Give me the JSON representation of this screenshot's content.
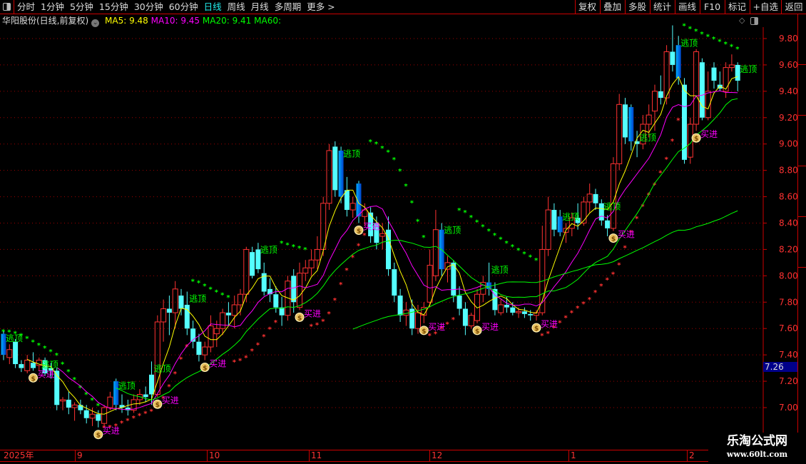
{
  "toolbar": {
    "periods": [
      "分时",
      "1分钟",
      "5分钟",
      "15分钟",
      "30分钟",
      "60分钟",
      "日线",
      "周线",
      "月线",
      "多周期",
      "更多 >"
    ],
    "active_period": "日线",
    "actions": [
      "复权",
      "叠加",
      "多股",
      "统计",
      "画线",
      "F10",
      "标记",
      "+自选",
      "返回"
    ]
  },
  "info": {
    "stock": "华阳股份(日线,前复权)",
    "ma5": "MA5: 9.48",
    "ma10": "MA10: 9.45",
    "ma20": "MA20: 9.41",
    "ma60": "MA60:"
  },
  "colors": {
    "up": "#ff3232",
    "down": "#54ffff",
    "ma5": "#ffff00",
    "ma10": "#ff00ff",
    "ma20": "#00ff00",
    "top_signal": "#00ff00",
    "buy_signal": "#ff00ff",
    "grid": "#a00000",
    "axis": "#ff3232"
  },
  "price_tag": "7.26",
  "time_axis": {
    "labels": [
      "2025年",
      "9",
      "10",
      "11",
      "12",
      "1",
      "2"
    ]
  },
  "watermark": {
    "line1": "乐淘公式网",
    "line2": "www.60lt.com"
  },
  "chart_data": {
    "type": "candlestick",
    "ylim": [
      6.8,
      9.95
    ],
    "yticks": [
      "9.80",
      "9.60",
      "9.40",
      "9.20",
      "9.00",
      "8.80",
      "8.60",
      "8.40",
      "8.20",
      "8.00",
      "7.80",
      "7.60",
      "7.40",
      "7.20",
      "7.00"
    ],
    "grid": true,
    "ohlc": [
      [
        7.56,
        7.58,
        7.36,
        7.4
      ],
      [
        7.38,
        7.48,
        7.33,
        7.44
      ],
      [
        7.5,
        7.52,
        7.3,
        7.33
      ],
      [
        7.33,
        7.36,
        7.27,
        7.3
      ],
      [
        7.28,
        7.4,
        7.26,
        7.36
      ],
      [
        7.34,
        7.42,
        7.28,
        7.3
      ],
      [
        7.32,
        7.38,
        7.28,
        7.36
      ],
      [
        7.36,
        7.38,
        7.24,
        7.26
      ],
      [
        7.3,
        7.34,
        7.22,
        7.28
      ],
      [
        7.28,
        7.3,
        6.98,
        7.02
      ],
      [
        7.05,
        7.08,
        6.98,
        7.06
      ],
      [
        7.06,
        7.12,
        6.95,
        7.0
      ],
      [
        7.0,
        7.04,
        6.9,
        7.02
      ],
      [
        7.02,
        7.06,
        6.95,
        6.98
      ],
      [
        6.98,
        7.02,
        6.88,
        6.92
      ],
      [
        6.92,
        7.0,
        6.86,
        6.95
      ],
      [
        6.95,
        6.98,
        6.85,
        6.9
      ],
      [
        6.88,
        7.02,
        6.85,
        7.0
      ],
      [
        7.0,
        7.12,
        6.98,
        7.08
      ],
      [
        7.2,
        7.22,
        6.98,
        7.02
      ],
      [
        7.02,
        7.1,
        6.96,
        7.0
      ],
      [
        7.0,
        7.06,
        6.94,
        6.98
      ],
      [
        6.98,
        7.1,
        6.96,
        7.06
      ],
      [
        7.06,
        7.14,
        7.02,
        7.1
      ],
      [
        7.1,
        7.16,
        7.04,
        7.08
      ],
      [
        7.25,
        7.35,
        7.02,
        7.1
      ],
      [
        7.1,
        7.7,
        7.08,
        7.65
      ],
      [
        7.65,
        7.82,
        7.5,
        7.75
      ],
      [
        7.75,
        7.85,
        7.55,
        7.72
      ],
      [
        7.72,
        7.96,
        7.6,
        7.9
      ],
      [
        7.85,
        7.9,
        7.7,
        7.75
      ],
      [
        7.78,
        7.88,
        7.55,
        7.6
      ],
      [
        7.6,
        7.66,
        7.45,
        7.5
      ],
      [
        7.5,
        7.56,
        7.35,
        7.4
      ],
      [
        7.4,
        7.5,
        7.36,
        7.46
      ],
      [
        7.46,
        7.7,
        7.42,
        7.62
      ],
      [
        7.56,
        7.66,
        7.46,
        7.6
      ],
      [
        7.6,
        7.75,
        7.55,
        7.72
      ],
      [
        7.72,
        7.8,
        7.62,
        7.7
      ],
      [
        7.7,
        7.85,
        7.6,
        7.78
      ],
      [
        7.78,
        7.9,
        7.7,
        7.86
      ],
      [
        7.86,
        8.22,
        7.8,
        8.2
      ],
      [
        8.18,
        8.22,
        7.98,
        8.0
      ],
      [
        8.2,
        8.25,
        8.02,
        8.05
      ],
      [
        8.02,
        8.1,
        7.85,
        7.88
      ],
      [
        7.9,
        7.98,
        7.8,
        7.86
      ],
      [
        7.86,
        7.92,
        7.72,
        7.76
      ],
      [
        7.76,
        7.84,
        7.62,
        7.7
      ],
      [
        7.7,
        8.0,
        7.66,
        7.96
      ],
      [
        8.0,
        8.05,
        7.72,
        7.8
      ],
      [
        7.76,
        8.1,
        7.74,
        8.02
      ],
      [
        8.02,
        8.12,
        7.96,
        8.06
      ],
      [
        8.06,
        8.2,
        8.0,
        8.12
      ],
      [
        8.12,
        8.3,
        8.05,
        8.2
      ],
      [
        8.2,
        8.6,
        8.15,
        8.55
      ],
      [
        8.55,
        9.0,
        8.5,
        8.95
      ],
      [
        8.98,
        9.02,
        8.6,
        8.65
      ],
      [
        8.95,
        8.98,
        8.55,
        8.6
      ],
      [
        8.65,
        8.75,
        8.45,
        8.5
      ],
      [
        8.5,
        8.6,
        8.44,
        8.55
      ],
      [
        8.7,
        8.72,
        8.4,
        8.45
      ],
      [
        8.45,
        8.55,
        8.38,
        8.5
      ],
      [
        8.48,
        8.52,
        8.25,
        8.3
      ],
      [
        8.4,
        8.45,
        8.2,
        8.25
      ],
      [
        8.3,
        8.4,
        8.2,
        8.32
      ],
      [
        8.35,
        8.45,
        8.0,
        8.05
      ],
      [
        8.05,
        8.1,
        7.8,
        7.85
      ],
      [
        7.85,
        7.9,
        7.65,
        7.7
      ],
      [
        7.7,
        7.8,
        7.62,
        7.74
      ],
      [
        7.75,
        7.82,
        7.55,
        7.6
      ],
      [
        7.6,
        7.78,
        7.56,
        7.72
      ],
      [
        7.7,
        7.8,
        7.64,
        7.76
      ],
      [
        7.8,
        8.2,
        7.76,
        8.08
      ],
      [
        8.0,
        8.5,
        7.96,
        8.35
      ],
      [
        8.35,
        8.4,
        8.0,
        8.05
      ],
      [
        8.05,
        8.15,
        7.95,
        8.1
      ],
      [
        8.1,
        8.12,
        7.8,
        7.85
      ],
      [
        7.85,
        7.92,
        7.7,
        7.75
      ],
      [
        7.75,
        7.8,
        7.55,
        7.62
      ],
      [
        7.62,
        7.72,
        7.6,
        7.7
      ],
      [
        7.66,
        7.9,
        7.64,
        7.86
      ],
      [
        7.86,
        8.0,
        7.8,
        7.95
      ],
      [
        7.95,
        8.1,
        7.85,
        7.9
      ],
      [
        7.9,
        7.95,
        7.7,
        7.74
      ],
      [
        7.72,
        7.82,
        7.7,
        7.78
      ],
      [
        7.78,
        7.84,
        7.72,
        7.76
      ],
      [
        7.76,
        7.8,
        7.7,
        7.72
      ],
      [
        7.72,
        7.76,
        7.68,
        7.73
      ],
      [
        7.73,
        7.76,
        7.68,
        7.71
      ],
      [
        7.71,
        7.74,
        7.66,
        7.7
      ],
      [
        7.7,
        7.74,
        7.66,
        7.72
      ],
      [
        7.72,
        8.38,
        7.7,
        8.2
      ],
      [
        8.2,
        8.6,
        8.15,
        8.5
      ],
      [
        8.5,
        8.55,
        8.3,
        8.35
      ],
      [
        8.45,
        8.5,
        8.3,
        8.33
      ],
      [
        8.33,
        8.4,
        8.25,
        8.36
      ],
      [
        8.36,
        8.48,
        8.3,
        8.44
      ],
      [
        8.44,
        8.55,
        8.35,
        8.4
      ],
      [
        8.4,
        8.6,
        8.38,
        8.56
      ],
      [
        8.56,
        8.7,
        8.48,
        8.62
      ],
      [
        8.62,
        8.66,
        8.5,
        8.55
      ],
      [
        8.55,
        8.58,
        8.38,
        8.42
      ],
      [
        8.42,
        8.46,
        8.3,
        8.36
      ],
      [
        8.36,
        8.9,
        8.34,
        8.85
      ],
      [
        8.85,
        9.38,
        8.8,
        9.3
      ],
      [
        9.3,
        9.35,
        9.0,
        9.05
      ],
      [
        9.28,
        9.3,
        8.95,
        9.02
      ],
      [
        9.02,
        9.1,
        8.9,
        9.0
      ],
      [
        9.0,
        9.22,
        8.96,
        9.15
      ],
      [
        9.15,
        9.3,
        9.05,
        9.22
      ],
      [
        9.25,
        9.45,
        9.1,
        9.4
      ],
      [
        9.4,
        9.52,
        9.3,
        9.35
      ],
      [
        9.35,
        9.75,
        9.3,
        9.7
      ],
      [
        9.7,
        9.9,
        9.55,
        9.6
      ],
      [
        9.75,
        9.82,
        9.45,
        9.5
      ],
      [
        9.45,
        9.5,
        8.85,
        8.88
      ],
      [
        8.9,
        9.2,
        8.85,
        9.15
      ],
      [
        9.15,
        9.72,
        9.1,
        9.7
      ],
      [
        9.62,
        9.65,
        9.18,
        9.2
      ],
      [
        9.2,
        9.55,
        9.18,
        9.4
      ],
      [
        9.58,
        9.62,
        9.42,
        9.48
      ],
      [
        9.45,
        9.55,
        9.4,
        9.42
      ],
      [
        9.4,
        9.62,
        9.35,
        9.58
      ],
      [
        9.58,
        9.68,
        9.55,
        9.6
      ],
      [
        9.6,
        9.62,
        9.4,
        9.48
      ]
    ],
    "highlight_candles": [
      0,
      19,
      57,
      60,
      74,
      82,
      94,
      106,
      114
    ],
    "series": [
      {
        "name": "MA5",
        "period": 5
      },
      {
        "name": "MA10",
        "period": 10
      },
      {
        "name": "MA20",
        "period": 20
      },
      {
        "name": "MA60",
        "period": 60
      }
    ],
    "signals": {
      "top_label": "逃顶",
      "buy_label": "买进",
      "top": [
        0,
        6,
        19,
        25,
        31,
        43,
        57,
        74,
        82,
        94,
        101,
        107,
        114,
        124
      ],
      "buy": [
        5,
        16,
        26,
        34,
        50,
        60,
        71,
        80,
        90,
        103,
        117
      ]
    }
  }
}
